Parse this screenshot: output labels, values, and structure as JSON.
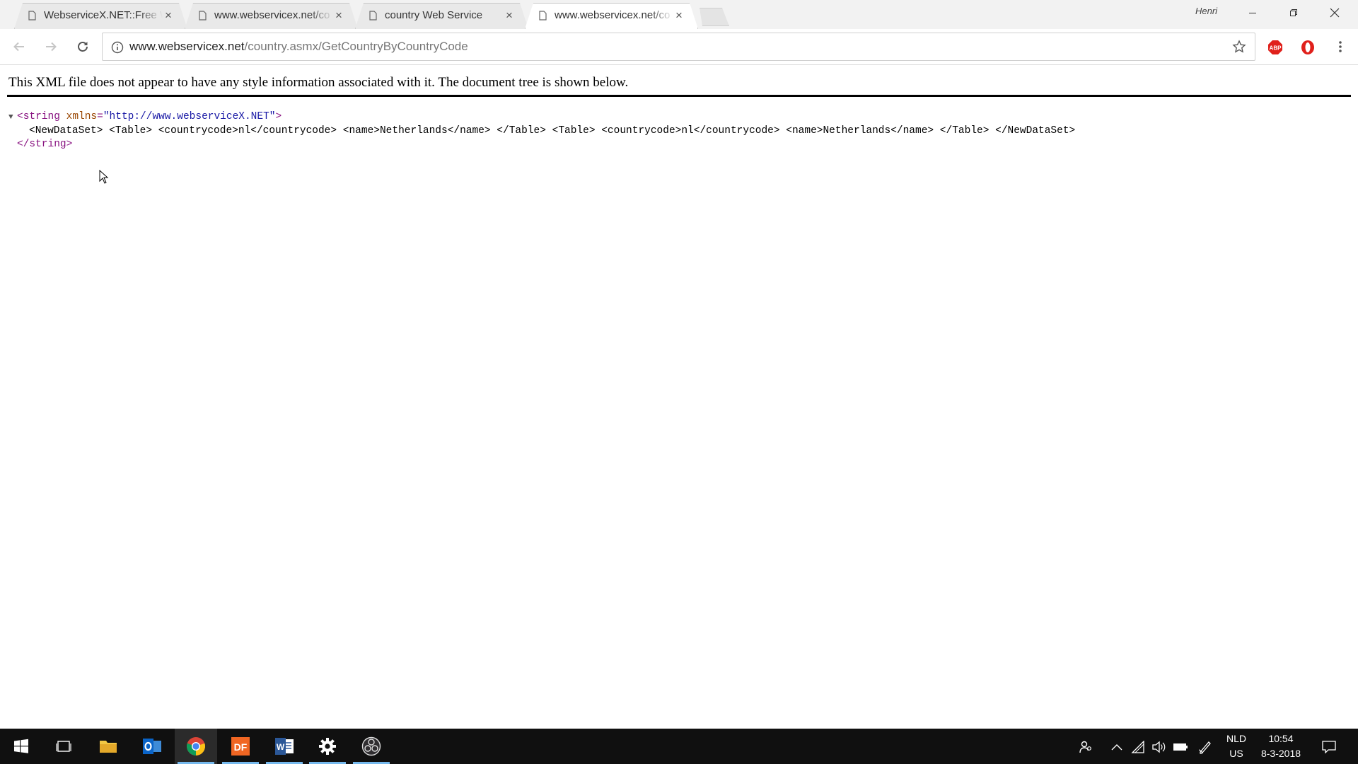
{
  "browser": {
    "tabs": [
      {
        "title": "WebserviceX.NET::Free W",
        "active": false
      },
      {
        "title": "www.webservicex.net/co",
        "active": false
      },
      {
        "title": "country Web Service",
        "active": false
      },
      {
        "title": "www.webservicex.net/co",
        "active": true
      }
    ],
    "close_glyph": "×",
    "profile_name": "Henri",
    "url_host": "www.webservicex.net",
    "url_path": "/country.asmx/GetCountryByCountryCode",
    "extensions": [
      "adblock-plus-icon",
      "opera-icon"
    ]
  },
  "page": {
    "banner": "This XML file does not appear to have any style information associated with it. The document tree is shown below.",
    "xml": {
      "triangle": "▼",
      "root_open_tag": "<string",
      "root_attr_name": "xmlns",
      "root_attr_eq": "=",
      "root_attr_value": "\"http://www.webserviceX.NET\"",
      "root_open_end": ">",
      "content": "<NewDataSet> <Table> <countrycode>nl</countrycode> <name>Netherlands</name> </Table> <Table> <countrycode>nl</countrycode> <name>Netherlands</name> </Table> </NewDataSet>",
      "root_close_tag": "</string>"
    }
  },
  "taskbar": {
    "apps": [
      "windows-start-icon",
      "task-view-icon",
      "file-explorer-icon",
      "outlook-icon",
      "chrome-icon",
      "dreamfactory-icon",
      "word-icon",
      "settings-icon",
      "obs-icon"
    ],
    "active_app": "chrome-icon",
    "language_top": "NLD",
    "language_bottom": "US",
    "time": "10:54",
    "date": "8-3-2018"
  },
  "colors": {
    "tag": "#881280",
    "attr_name": "#994500",
    "attr_value": "#1a1aa6",
    "taskbar": "#101010",
    "taskbar_running": "#76b9ed"
  }
}
